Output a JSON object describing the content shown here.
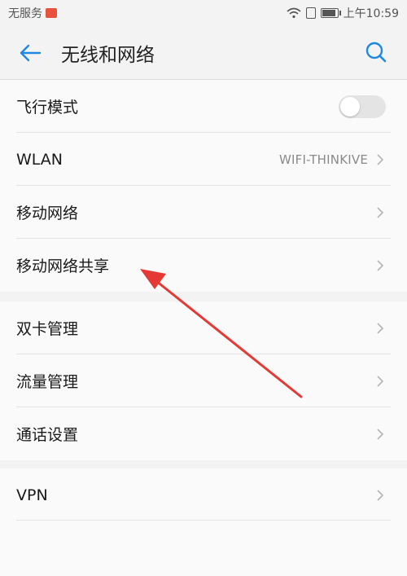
{
  "status_bar": {
    "carrier": "无服务",
    "time": "上午10:59"
  },
  "header": {
    "title": "无线和网络",
    "back_icon": "back-arrow-icon",
    "search_icon": "search-icon"
  },
  "colors": {
    "accent": "#1e88e5",
    "annotation_arrow": "#e53935"
  },
  "settings": {
    "group1": [
      {
        "label": "飞行模式",
        "control": "toggle",
        "toggle_on": false
      },
      {
        "label": "WLAN",
        "value": "WIFI-THINKIVE"
      },
      {
        "label": "移动网络"
      },
      {
        "label": "移动网络共享"
      }
    ],
    "group2": [
      {
        "label": "双卡管理"
      },
      {
        "label": "流量管理"
      },
      {
        "label": "通话设置"
      }
    ],
    "group3": [
      {
        "label": "VPN"
      }
    ]
  }
}
